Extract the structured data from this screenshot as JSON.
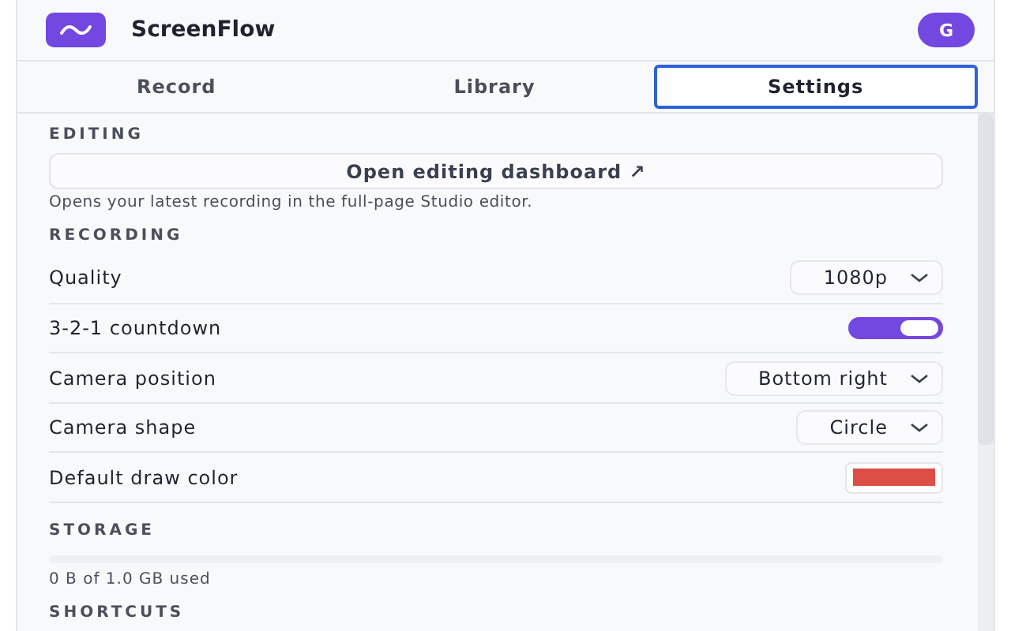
{
  "header": {
    "app_name": "ScreenFlow",
    "avatar": "G"
  },
  "tabs": [
    {
      "label": "Record",
      "selected": false
    },
    {
      "label": "Library",
      "selected": false
    },
    {
      "label": "Settings",
      "selected": true
    }
  ],
  "editing": {
    "heading": "EDITING",
    "button": "Open editing dashboard ↗",
    "hint": "Opens your latest recording in the full-page Studio editor."
  },
  "recording": {
    "heading": "RECORDING",
    "settings": [
      {
        "kind": "select",
        "label": "Quality",
        "value": "1080p"
      },
      {
        "kind": "toggle",
        "label": "3-2-1 countdown",
        "on": true
      },
      {
        "kind": "select",
        "label": "Camera position",
        "value": "Bottom right"
      },
      {
        "kind": "select",
        "label": "Camera shape",
        "value": "Circle"
      },
      {
        "kind": "color",
        "label": "Default draw color",
        "color": "#dc4e46"
      }
    ]
  },
  "storage": {
    "heading": "STORAGE",
    "level": 0,
    "usage": "0 B of 1.0 GB used"
  },
  "shortcuts": {
    "heading": "SHORTCUTS"
  }
}
